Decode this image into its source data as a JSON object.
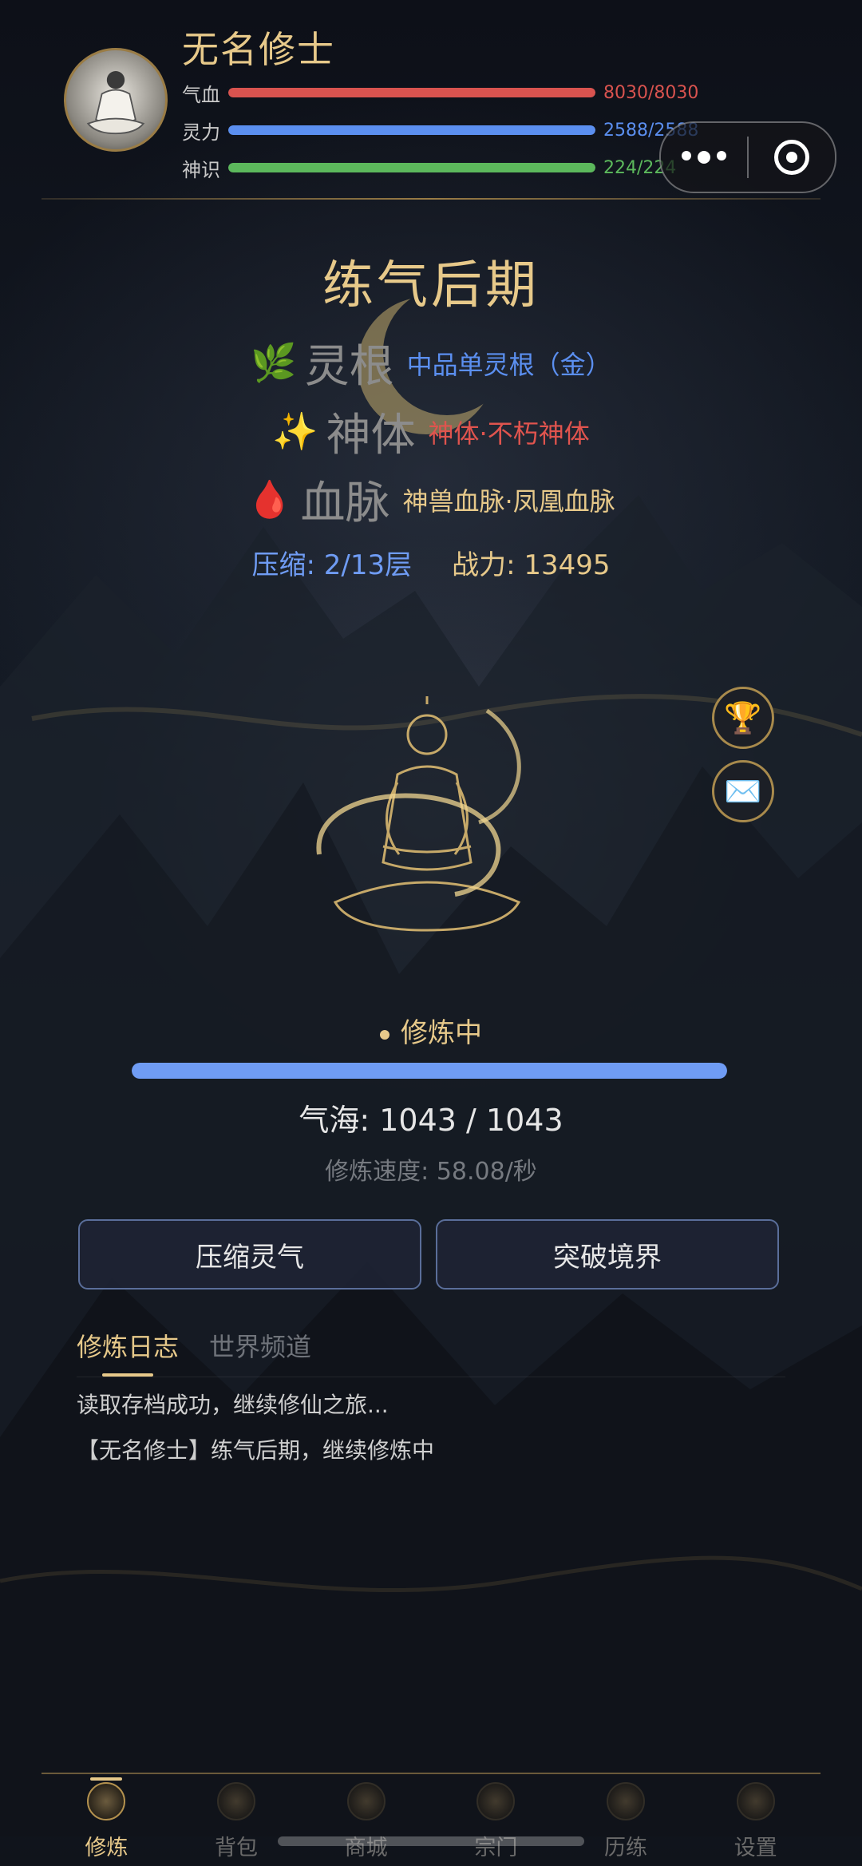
{
  "player": {
    "name": "无名修士",
    "stats": [
      {
        "label": "气血",
        "value": "8030/8030",
        "fraction": 1.0,
        "color": "#d9534f"
      },
      {
        "label": "灵力",
        "value": "2588/2588",
        "fraction": 1.0,
        "color": "#5b8ff0"
      },
      {
        "label": "神识",
        "value": "224/224",
        "fraction": 1.0,
        "color": "#5cb85c"
      }
    ]
  },
  "realm": "练气后期",
  "attributes": [
    {
      "icon": "🌿",
      "title": "灵根",
      "value": "中品单灵根（金）",
      "color": "#5b8ff0"
    },
    {
      "icon": "✨",
      "title": "神体",
      "value": "神体·不朽神体",
      "color": "#e0544e"
    },
    {
      "icon": "🩸",
      "title": "血脉",
      "value": "神兽血脉·凤凰血脉",
      "color": "#e7c98a"
    }
  ],
  "compression": {
    "label": "压缩: 2/13层",
    "color": "#6f9cf4"
  },
  "power": {
    "label": "战力: 13495",
    "color": "#e7c98a"
  },
  "side_buttons": [
    {
      "icon": "🏆",
      "name": "trophy-icon"
    },
    {
      "icon": "✉️",
      "name": "mail-icon"
    }
  ],
  "cultivation": {
    "status": "修炼中",
    "progress_fraction": 1.0,
    "qihai": "气海: 1043 / 1043",
    "speed": "修炼速度: 58.08/秒"
  },
  "actions": {
    "compress": "压缩灵气",
    "breakthrough": "突破境界"
  },
  "tabs": [
    {
      "label": "修炼日志",
      "active": true
    },
    {
      "label": "世界频道",
      "active": false
    }
  ],
  "log": [
    "读取存档成功，继续修仙之旅...",
    "【无名修士】练气后期，继续修炼中"
  ],
  "nav": [
    {
      "label": "修炼",
      "active": true
    },
    {
      "label": "背包",
      "active": false
    },
    {
      "label": "商城",
      "active": false
    },
    {
      "label": "宗门",
      "active": false
    },
    {
      "label": "历练",
      "active": false
    },
    {
      "label": "设置",
      "active": false
    }
  ]
}
